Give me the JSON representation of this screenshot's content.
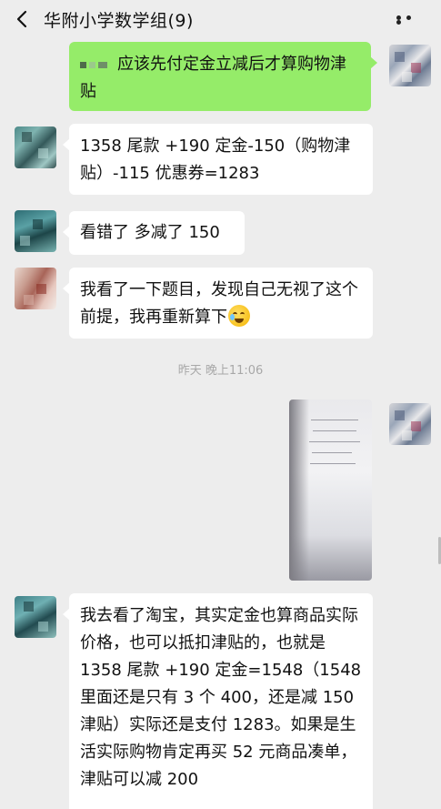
{
  "header": {
    "title": "华附小学数学组(9)"
  },
  "messages": {
    "m1_text": "应该先付定金立减后才算购物津贴",
    "m2_text": "1358 尾款 +190 定金-150（购物津贴）-115 优惠券=1283",
    "m3_text": "看错了 多减了 150",
    "m4_text": "我看了一下题目，发现自己无视了这个前提，我再重新算下",
    "m6_text": "我去看了淘宝，其实定金也算商品实际价格，也可以抵扣津贴的，也就是 1358 尾款 +190 定金=1548（1548 里面还是只有 3 个 400，还是减 150 津贴）实际还是支付 1283。如果是生活实际购物肯定再买 52 元商品凑单，津贴可以减 200"
  },
  "timestamp": "昨天 晚上11:06",
  "colors": {
    "background": "#ededed",
    "bubble_self": "#95ec69",
    "bubble_other": "#ffffff"
  },
  "icons": {
    "back": "chevron-left-icon",
    "more": "more-dots-icon",
    "emoji": "tearful-laugh-emoji"
  }
}
